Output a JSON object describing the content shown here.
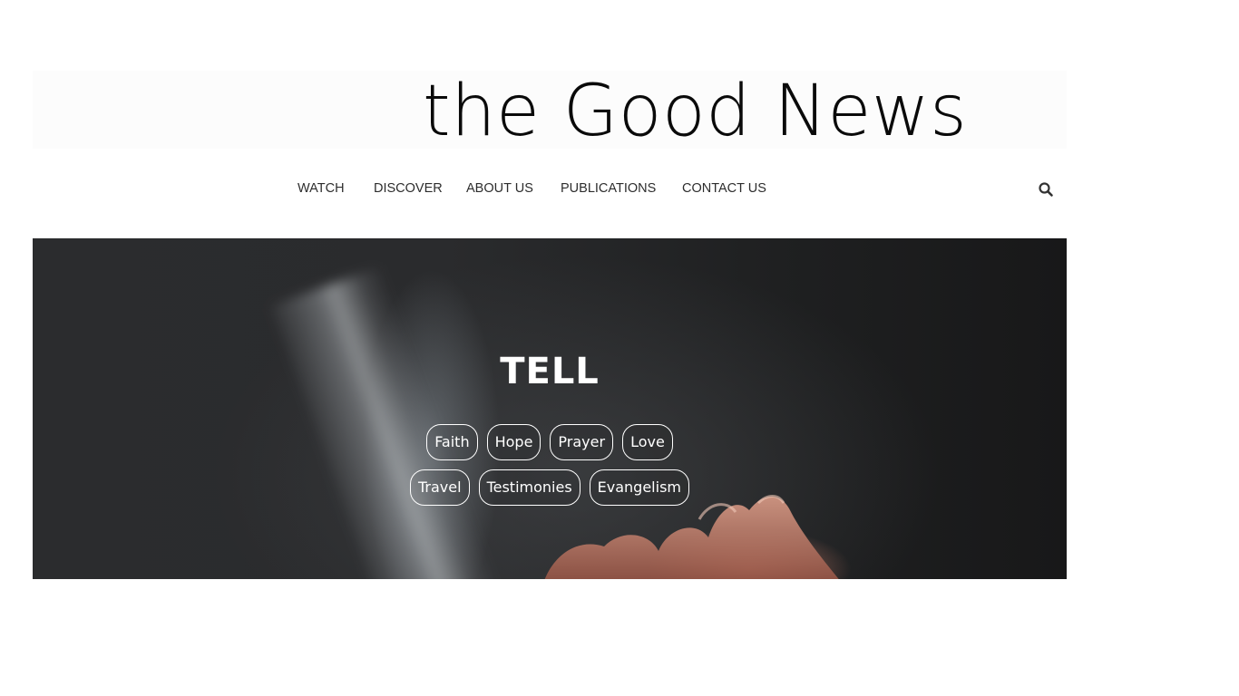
{
  "site": {
    "logo_text": "the Good News"
  },
  "nav": {
    "items": [
      {
        "label": "WATCH"
      },
      {
        "label": "DISCOVER"
      },
      {
        "label": "ABOUT US"
      },
      {
        "label": "PUBLICATIONS"
      },
      {
        "label": "CONTACT US"
      }
    ],
    "search_icon": "search-icon"
  },
  "hero": {
    "title": "TELL",
    "tags_row1": [
      "Faith",
      "Hope",
      "Prayer",
      "Love"
    ],
    "tags_row2": [
      "Travel",
      "Testimonies",
      "Evangelism"
    ]
  },
  "colors": {
    "text": "#2d2d2d",
    "hero_text": "#ffffff",
    "hero_bg": "#2a2b2d"
  }
}
